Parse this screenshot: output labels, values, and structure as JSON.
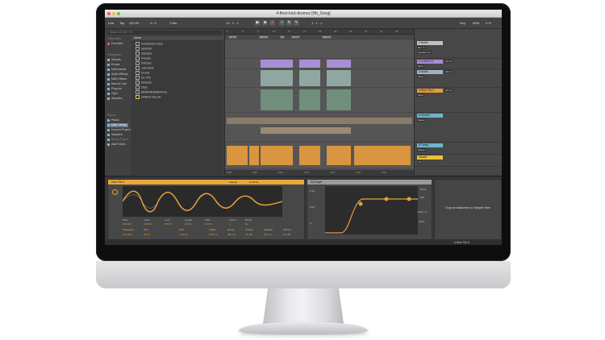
{
  "window": {
    "title": "4-floor-kick-drumzz  [Hit_Song]"
  },
  "controlbar": {
    "link": "Link",
    "tap": "Tap",
    "tempo": "120.00",
    "signature": "4 / 4",
    "quantize": "1 Bar",
    "position": "12 . 1 . 1",
    "end": "1 . 1 . 1",
    "key": "Key",
    "midi": "MIDI",
    "cpu": "4 %"
  },
  "browser": {
    "search_placeholder": "Search (Cmd + F)",
    "collections_head": "Collections",
    "collections": [
      "Favorites"
    ],
    "categories_head": "Categories",
    "categories": [
      "Sounds",
      "Drums",
      "Instruments",
      "Audio Effects",
      "MIDI Effects",
      "Max for Live",
      "Plug-ins",
      "Clips",
      "Samples"
    ],
    "places_head": "Places",
    "places": [
      "Packs",
      "User Library",
      "Current Project",
      "Samples",
      "Music Project",
      "Add Folder..."
    ],
    "name_head": "Name",
    "files": [
      "Grossmann Pack",
      "Synth3ti",
      "Samples",
      "Presets",
      "Patches",
      "Just Ideas",
      "Drums",
      "Do This",
      "Defaults",
      "Clips",
      "[ARRANGEMENTS]",
      "Untitled Clip.als"
    ]
  },
  "arrangement": {
    "ruler_ticks": [
      "1",
      "5",
      "9",
      "13",
      "17",
      "21",
      "25",
      "29",
      "33",
      "37",
      "41",
      "45"
    ],
    "locators": [
      "INTRO",
      "BREAK",
      "BU",
      "DROP",
      "BREAK"
    ],
    "time_ticks": [
      "0:00",
      "0:20",
      "0:40",
      "1:00",
      "1:20",
      "1:40",
      "2:00"
    ]
  },
  "mixer": {
    "tracks": [
      {
        "name": "1 Audio",
        "input": "Ext. In",
        "route": "Speaker On",
        "color": "#c0c0c0"
      },
      {
        "name": "2 4-Kick 2 0",
        "input": "All Ins",
        "route": "Mixer",
        "color": "#a58fd3"
      },
      {
        "name": "3 Audio",
        "input": "All Ins",
        "route": "Mixer",
        "color": "#9fb3bf"
      },
      {
        "name": "4 Kick 70s 2",
        "input": "All Ins",
        "route": "Mixer",
        "color": "#e79a3a"
      },
      {
        "name": "A Reverb",
        "input": "",
        "route": "Master",
        "color": "#6fb4c8"
      },
      {
        "name": "B Delay",
        "input": "",
        "route": "Master",
        "color": "#6fb4c8"
      },
      {
        "name": "Master",
        "input": "",
        "route": "1/2",
        "color": "#e8c23a"
      }
    ],
    "io_labels": [
      "Speaker On",
      "In",
      "Auto",
      "Off",
      "Master"
    ]
  },
  "device": {
    "sampler_title": "Kick 70s 2",
    "sample_label": "Sample",
    "controls_label": "Controls",
    "params": [
      {
        "label": "Gain",
        "value": "0.00 dB"
      },
      {
        "label": "Start",
        "value": "0.00 %"
      },
      {
        "label": "Loop",
        "value": "0.00 %"
      },
      {
        "label": "Length",
        "value": "100 %"
      },
      {
        "label": "Fade",
        "value": "0.00 %"
      },
      {
        "label": "Voices",
        "value": "1"
      },
      {
        "label": "Retrig",
        "value": "On"
      }
    ],
    "filter_params": [
      {
        "label": "Frequency",
        "value": "22.0 kHz"
      },
      {
        "label": "Res",
        "value": "0.0 %"
      },
      {
        "label": "LFO",
        "value": "1.00 Hz"
      },
      {
        "label": "Attack",
        "value": "0.00 ms"
      },
      {
        "label": "Decay",
        "value": "600 ms"
      },
      {
        "label": "Sustain",
        "value": "0.0 dB"
      },
      {
        "label": "Release",
        "value": "50.0 ms"
      },
      {
        "label": "Volume",
        "value": "0.0 dB"
      }
    ],
    "eq_title": "EQ Eight",
    "eq_freq": "Freq",
    "eq_gain": "Gain",
    "eq_q": "Q",
    "eq_scale": "Scale",
    "eq_adapt": "Adapt. Q",
    "eq_mode": "Mode",
    "eq_edit": "Edit",
    "drop_text": "Drop an Instrument or Sample Here"
  },
  "status": {
    "track": "4-Kick 70s 2"
  }
}
